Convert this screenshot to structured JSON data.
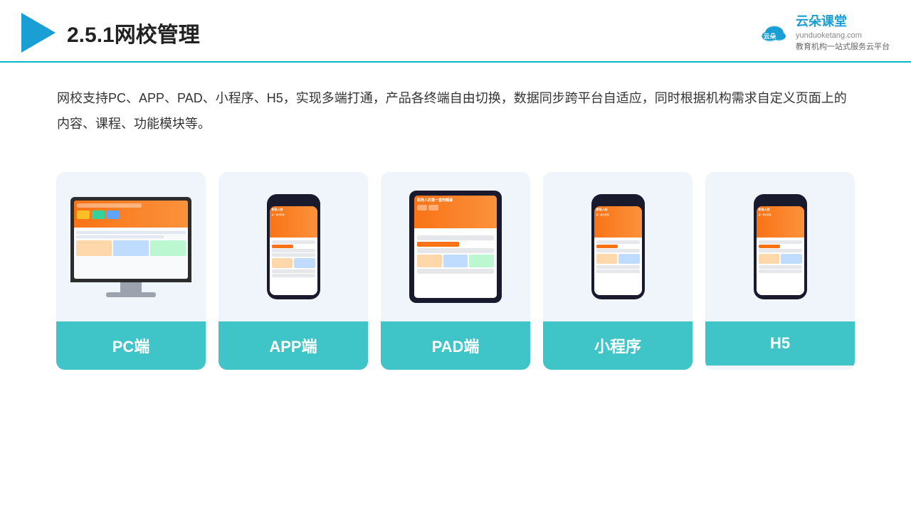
{
  "header": {
    "title": "2.5.1网校管理",
    "brand": {
      "name": "云朵课堂",
      "domain": "yunduoketang.com",
      "tagline": "教育机构一站\n式服务云平台"
    }
  },
  "description": {
    "text": "网校支持PC、APP、PAD、小程序、H5，实现多端打通，产品各终端自由切换，数据同步跨平台自适应，同时根据机构需求自定义页面上的内容、课程、功能模块等。"
  },
  "cards": [
    {
      "id": "pc",
      "label": "PC端"
    },
    {
      "id": "app",
      "label": "APP端"
    },
    {
      "id": "pad",
      "label": "PAD端"
    },
    {
      "id": "miniapp",
      "label": "小程序"
    },
    {
      "id": "h5",
      "label": "H5"
    }
  ],
  "colors": {
    "accent": "#3fc4c8",
    "header_line": "#00b8c8",
    "triangle": "#1a9fd4",
    "brand_blue": "#1a9fd4"
  }
}
